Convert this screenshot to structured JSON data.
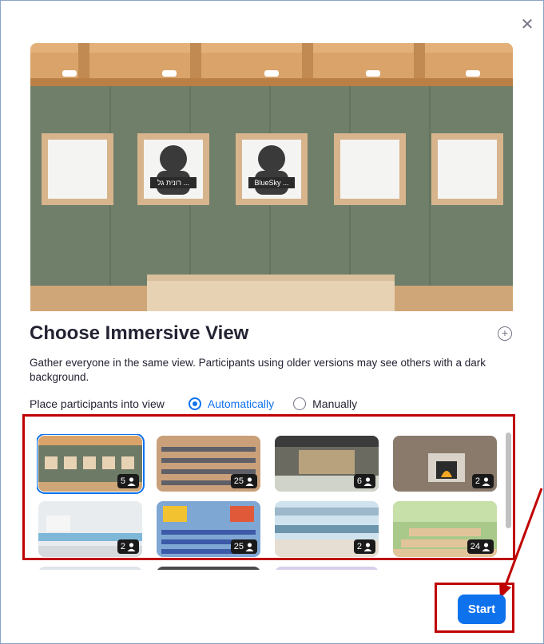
{
  "dialog": {
    "title": "Choose Immersive View",
    "description": "Gather everyone in the same view. Participants using older versions may see others with a dark background.",
    "close_icon": "close-icon",
    "add_icon": "plus-circle-icon"
  },
  "preview": {
    "scene": "art-gallery",
    "frames": [
      {
        "name": "",
        "has_avatar": false
      },
      {
        "name": "רונית גל ...",
        "has_avatar": true
      },
      {
        "name": "BlueSky ...",
        "has_avatar": true
      },
      {
        "name": "",
        "has_avatar": false
      },
      {
        "name": "",
        "has_avatar": false
      }
    ]
  },
  "placement": {
    "label": "Place participants into view",
    "options": [
      {
        "label": "Automatically",
        "selected": true
      },
      {
        "label": "Manually",
        "selected": false
      }
    ]
  },
  "scenes": [
    {
      "name": "gallery",
      "count": "5",
      "selected": true
    },
    {
      "name": "auditorium",
      "count": "25",
      "selected": false
    },
    {
      "name": "lounge",
      "count": "6",
      "selected": false
    },
    {
      "name": "fireplace",
      "count": "2",
      "selected": false
    },
    {
      "name": "office",
      "count": "2",
      "selected": false
    },
    {
      "name": "classroom",
      "count": "25",
      "selected": false
    },
    {
      "name": "kitchen",
      "count": "2",
      "selected": false
    },
    {
      "name": "treehouse",
      "count": "24",
      "selected": false
    }
  ],
  "actions": {
    "start_label": "Start"
  },
  "colors": {
    "accent": "#0e72ed",
    "highlight": "#c00000"
  }
}
